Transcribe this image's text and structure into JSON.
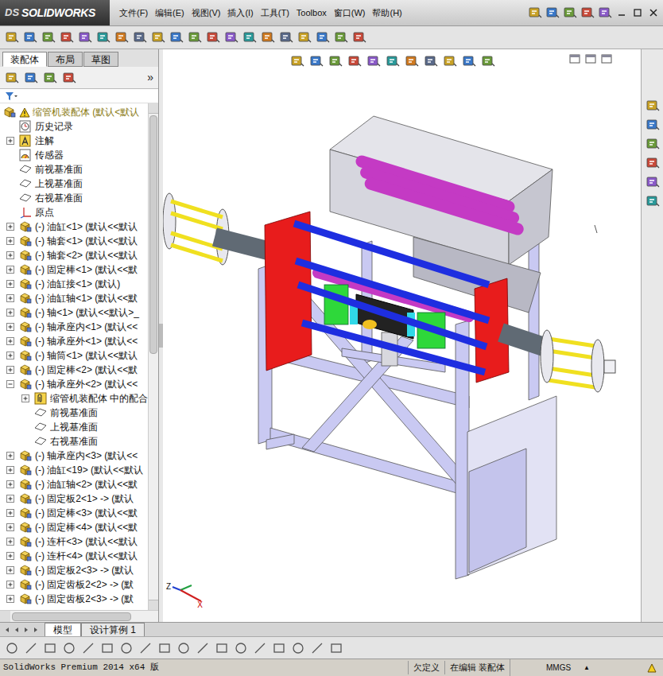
{
  "window": {
    "logo_mark": "DS",
    "app_name": "SOLIDWORKS"
  },
  "menu": [
    {
      "label": "文件(F)"
    },
    {
      "label": "编辑(E)"
    },
    {
      "label": "视图(V)"
    },
    {
      "label": "插入(I)"
    },
    {
      "label": "工具(T)"
    },
    {
      "label": "Toolbox"
    },
    {
      "label": "窗口(W)"
    },
    {
      "label": "帮助(H)"
    }
  ],
  "panel_tabs": [
    {
      "label": "装配体",
      "selected": true
    },
    {
      "label": "布局",
      "selected": false
    },
    {
      "label": "草图",
      "selected": false
    }
  ],
  "panel_more": "»",
  "tree": {
    "root": {
      "label": "缩管机装配体  (默认<默认",
      "warning": true
    },
    "items": [
      {
        "label": "历史记录",
        "kind": "history",
        "expandable": false
      },
      {
        "label": "注解",
        "kind": "annotation",
        "expandable": true,
        "expanded": false
      },
      {
        "label": "传感器",
        "kind": "sensor",
        "expandable": false
      },
      {
        "label": "前视基准面",
        "kind": "plane",
        "expandable": false
      },
      {
        "label": "上视基准面",
        "kind": "plane",
        "expandable": false
      },
      {
        "label": "右视基准面",
        "kind": "plane",
        "expandable": false
      },
      {
        "label": "原点",
        "kind": "origin",
        "expandable": false
      },
      {
        "label": "(-) 油缸<1>  (默认<<默认",
        "kind": "component",
        "expandable": true,
        "expanded": false
      },
      {
        "label": "(-) 轴套<1>  (默认<<默认",
        "kind": "component",
        "expandable": true,
        "expanded": false
      },
      {
        "label": "(-) 轴套<2>  (默认<<默认",
        "kind": "component",
        "expandable": true,
        "expanded": false
      },
      {
        "label": "(-) 固定棒<1>  (默认<<默",
        "kind": "component",
        "expandable": true,
        "expanded": false
      },
      {
        "label": "(-) 油缸接<1>  (默认)",
        "kind": "component",
        "expandable": true,
        "expanded": false
      },
      {
        "label": "(-) 油缸轴<1>  (默认<<默",
        "kind": "component",
        "expandable": true,
        "expanded": false
      },
      {
        "label": "(-) 轴<1>  (默认<<默认>_",
        "kind": "component",
        "expandable": true,
        "expanded": false
      },
      {
        "label": "(-) 轴承座内<1>  (默认<<",
        "kind": "component",
        "expandable": true,
        "expanded": false
      },
      {
        "label": "(-) 轴承座外<1>  (默认<<",
        "kind": "component",
        "expandable": true,
        "expanded": false
      },
      {
        "label": "(-) 轴筒<1>  (默认<<默认",
        "kind": "component",
        "expandable": true,
        "expanded": false
      },
      {
        "label": "(-) 固定棒<2>  (默认<<默",
        "kind": "component",
        "expandable": true,
        "expanded": false
      },
      {
        "label": "(-) 轴承座外<2>  (默认<<",
        "kind": "component",
        "expandable": true,
        "expanded": true,
        "children": [
          {
            "label": "缩管机装配体 中的配合",
            "kind": "mates",
            "expandable": true,
            "expanded": false
          },
          {
            "label": "前视基准面",
            "kind": "plane",
            "expandable": false
          },
          {
            "label": "上视基准面",
            "kind": "plane",
            "expandable": false
          },
          {
            "label": "右视基准面",
            "kind": "plane",
            "expandable": false
          }
        ]
      },
      {
        "label": "(-) 轴承座内<3>  (默认<<",
        "kind": "component",
        "expandable": true,
        "expanded": false
      },
      {
        "label": "(-) 油缸<19>  (默认<<默认",
        "kind": "component",
        "expandable": true,
        "expanded": false
      },
      {
        "label": "(-) 油缸轴<2>  (默认<<默",
        "kind": "component",
        "expandable": true,
        "expanded": false
      },
      {
        "label": "(-) 固定板2<1> ->  (默认",
        "kind": "component",
        "expandable": true,
        "expanded": false
      },
      {
        "label": "(-) 固定棒<3>  (默认<<默",
        "kind": "component",
        "expandable": true,
        "expanded": false
      },
      {
        "label": "(-) 固定棒<4>  (默认<<默",
        "kind": "component",
        "expandable": true,
        "expanded": false
      },
      {
        "label": "(-) 连杆<3>  (默认<<默认",
        "kind": "component",
        "expandable": true,
        "expanded": false
      },
      {
        "label": "(-) 连杆<4>  (默认<<默认",
        "kind": "component",
        "expandable": true,
        "expanded": false
      },
      {
        "label": "(-) 固定板2<3> ->  (默认",
        "kind": "component",
        "expandable": true,
        "expanded": false
      },
      {
        "label": "(-) 固定齿板2<2> ->  (默",
        "kind": "component",
        "expandable": true,
        "expanded": false
      },
      {
        "label": "(-) 固定齿板2<3> ->  (默",
        "kind": "component",
        "expandable": true,
        "expanded": false
      }
    ]
  },
  "bottom_tabs": [
    {
      "label": "模型",
      "selected": true
    },
    {
      "label": "设计算例 1",
      "selected": false
    }
  ],
  "status_bar": {
    "product": "SolidWorks Premium 2014 x64 版",
    "definition": "欠定义",
    "mode": "在编辑 装配体",
    "units": "MMGS",
    "units_arrow": "▲"
  },
  "triad": [
    "Z",
    "X"
  ]
}
